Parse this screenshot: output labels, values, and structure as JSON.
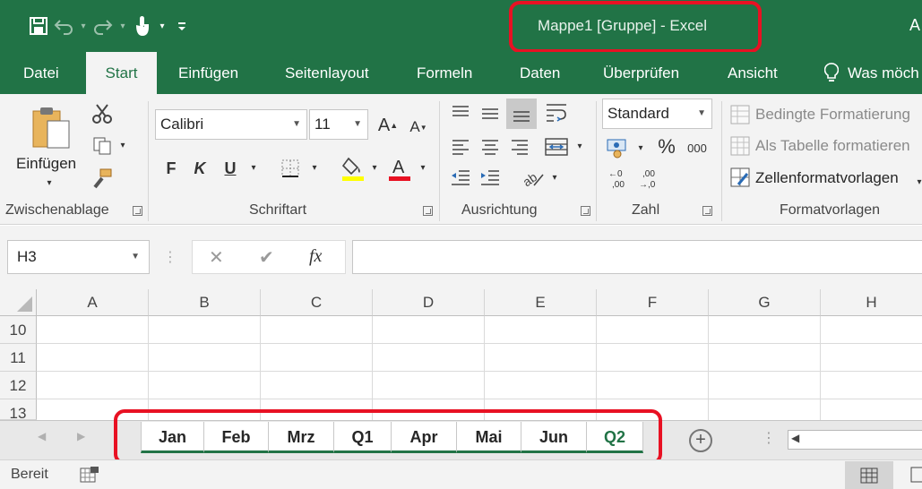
{
  "window": {
    "title": "Mappe1  [Gruppe]  -  Excel",
    "title_cut": "A"
  },
  "tabs": [
    {
      "label": "Datei"
    },
    {
      "label": "Start"
    },
    {
      "label": "Einfügen"
    },
    {
      "label": "Seitenlayout"
    },
    {
      "label": "Formeln"
    },
    {
      "label": "Daten"
    },
    {
      "label": "Überprüfen"
    },
    {
      "label": "Ansicht"
    },
    {
      "label": "Was möch"
    }
  ],
  "ribbon": {
    "clipboard": {
      "paste_label": "Einfügen",
      "group_label": "Zwischenablage"
    },
    "font": {
      "font_name": "Calibri",
      "font_size": "11",
      "bold": "F",
      "italic": "K",
      "underline": "U",
      "group_label": "Schriftart"
    },
    "alignment": {
      "group_label": "Ausrichtung"
    },
    "number": {
      "format": "Standard",
      "percent": "%",
      "thousands": "000",
      "group_label": "Zahl"
    },
    "styles": {
      "conditional": "Bedingte Formatierung",
      "as_table": "Als Tabelle formatieren",
      "cell_styles": "Zellenformatvorlagen",
      "group_label": "Formatvorlagen"
    }
  },
  "formula_bar": {
    "name_box": "H3",
    "fx": "fx",
    "formula": ""
  },
  "grid": {
    "columns": [
      "A",
      "B",
      "C",
      "D",
      "E",
      "F",
      "G",
      "H"
    ],
    "rows": [
      "10",
      "11",
      "12",
      "13"
    ]
  },
  "sheets": [
    {
      "name": "Jan"
    },
    {
      "name": "Feb"
    },
    {
      "name": "Mrz"
    },
    {
      "name": "Q1"
    },
    {
      "name": "Apr"
    },
    {
      "name": "Mai"
    },
    {
      "name": "Jun"
    },
    {
      "name": "Q2"
    }
  ],
  "status": {
    "text": "Bereit"
  },
  "colors": {
    "excel_green": "#217346",
    "highlight_red": "#e81123"
  }
}
